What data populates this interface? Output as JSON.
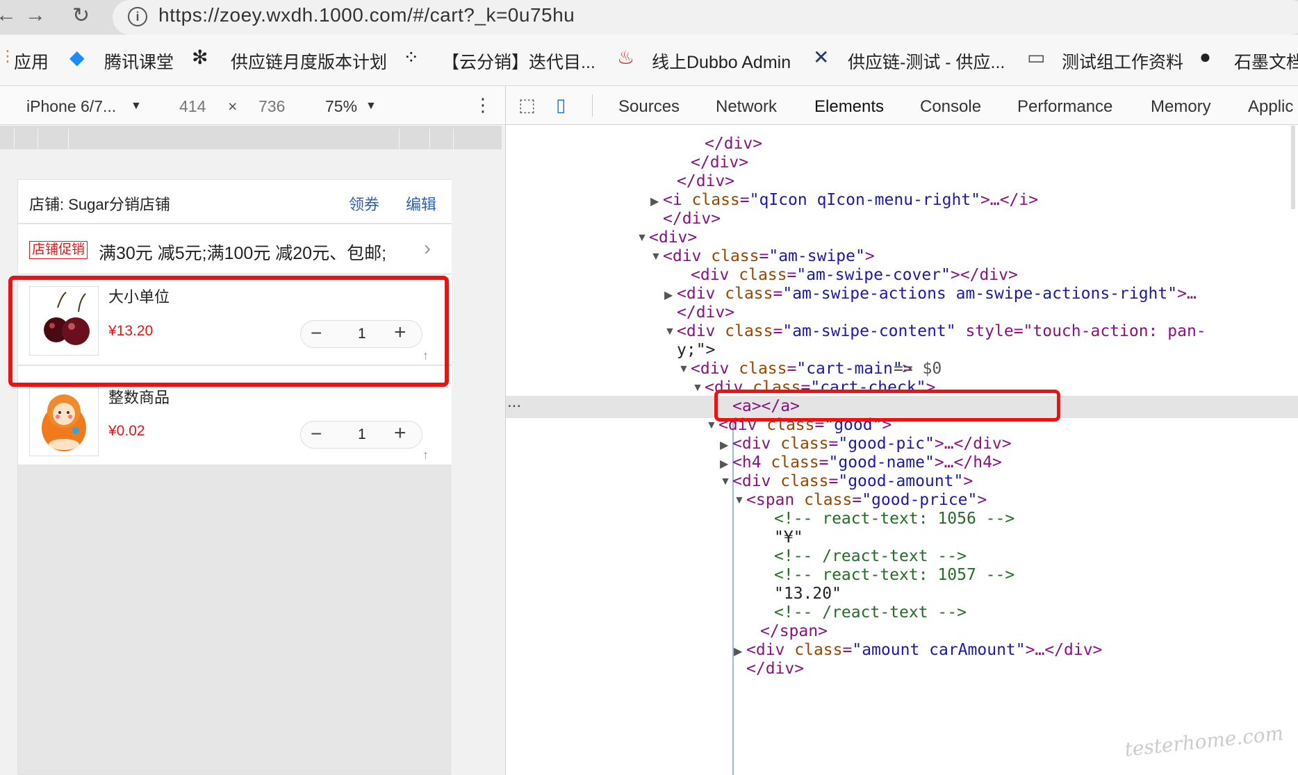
{
  "browser": {
    "url": "https://zoey.wxdh.1000.com/#/cart?_k=0u75hu",
    "bookmarks": [
      "应用",
      "腾讯课堂",
      "供应链月度版本计划",
      "【云分销】迭代目...",
      "线上Dubbo Admin",
      "供应链-测试 - 供应...",
      "测试组工作资料",
      "石墨文档"
    ]
  },
  "devtools": {
    "device": "iPhone 6/7...",
    "width": "414",
    "times": "×",
    "height": "736",
    "zoom": "75%",
    "tabs": [
      "Sources",
      "Network",
      "Elements",
      "Console",
      "Performance",
      "Memory",
      "Applic"
    ],
    "active_tab": "Elements",
    "eq": "== $0",
    "ellipsis": "..."
  },
  "shop": {
    "title": "店铺: Sugar分销店铺",
    "coupon": "领券",
    "edit": "编辑",
    "promo_badge": "店铺促销",
    "promo_text": "满30元 减5元;满100元 减20元、包邮;"
  },
  "items": [
    {
      "name": "大小单位",
      "price": "¥13.20",
      "qty": "1"
    },
    {
      "name": "整数商品",
      "price": "¥0.02",
      "qty": "1"
    }
  ],
  "code_lines": [
    {
      "indent": 0,
      "text": "</div>"
    },
    {
      "indent": 0,
      "text": "</div>"
    },
    {
      "indent": 0,
      "text": "</div>"
    },
    {
      "indent": 0,
      "text": "<i class=\"qIcon qIcon-menu-right\">…</i>"
    },
    {
      "indent": 0,
      "text": "</div>"
    },
    {
      "indent": 0,
      "text": "<div>"
    },
    {
      "indent": 0,
      "text": "<div class=\"am-swipe\">"
    },
    {
      "indent": 0,
      "text": "<div class=\"am-swipe-cover\"></div>"
    },
    {
      "indent": 0,
      "text": "<div class=\"am-swipe-actions am-swipe-actions-right\">…"
    },
    {
      "indent": 0,
      "text": "</div>"
    },
    {
      "indent": 0,
      "text": "<div class=\"am-swipe-content\" style=\"touch-action: pan-"
    },
    {
      "indent": 0,
      "text": "y;\">"
    },
    {
      "indent": 0,
      "text": "<div class=\"cart-main\">"
    },
    {
      "indent": 0,
      "text": "<div class=\"cart-check\">"
    },
    {
      "indent": 0,
      "text": "<a></a>"
    },
    {
      "indent": 0,
      "text": "<div class=\"good\">"
    },
    {
      "indent": 0,
      "text": "<div class=\"good-pic\">…</div>"
    },
    {
      "indent": 0,
      "text": "<h4 class=\"good-name\">…</h4>"
    },
    {
      "indent": 0,
      "text": "<div class=\"good-amount\">"
    },
    {
      "indent": 0,
      "text": "<span class=\"good-price\">"
    },
    {
      "indent": 0,
      "text": "<!-- react-text: 1056 -->"
    },
    {
      "indent": 0,
      "text": "\"¥\""
    },
    {
      "indent": 0,
      "text": "<!-- /react-text -->"
    },
    {
      "indent": 0,
      "text": "<!-- react-text: 1057 -->"
    },
    {
      "indent": 0,
      "text": "\"13.20\""
    },
    {
      "indent": 0,
      "text": "<!-- /react-text -->"
    },
    {
      "indent": 0,
      "text": "</span>"
    },
    {
      "indent": 0,
      "text": "<div class=\"amount carAmount\">…</div>"
    },
    {
      "indent": 0,
      "text": "</div>"
    }
  ],
  "watermark": "testerhome.com"
}
